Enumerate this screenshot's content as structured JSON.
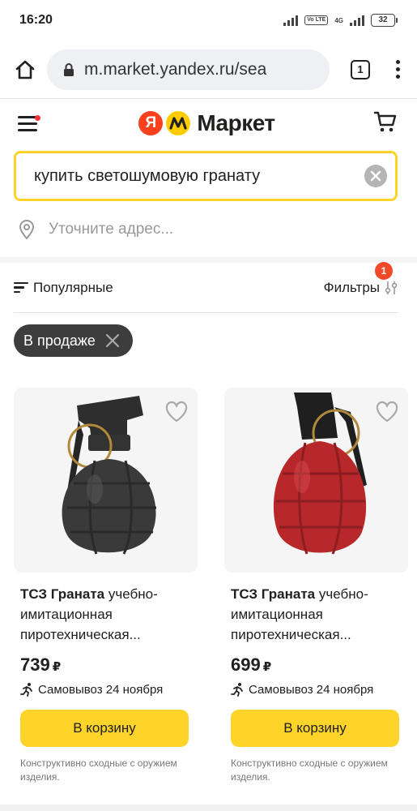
{
  "status_bar": {
    "time": "16:20",
    "network": "4G",
    "volte": "Vo LTE",
    "battery": "32"
  },
  "browser": {
    "url": "m.market.yandex.ru/sea",
    "tab_count": "1"
  },
  "header": {
    "logo_text": "Маркет",
    "logo_ya": "Я"
  },
  "search": {
    "value": "купить светошумовую гранату"
  },
  "address": {
    "placeholder": "Уточните адрес..."
  },
  "controls": {
    "sort_label": "Популярные",
    "filters_label": "Фильтры",
    "filters_badge": "1"
  },
  "chips": [
    {
      "label": "В продаже"
    }
  ],
  "products": [
    {
      "title_bold": "ТСЗ Граната",
      "title_rest": " учебно-имитационная пиротехническая...",
      "price": "739",
      "currency": "₽",
      "delivery": "Самовывоз 24 ноября",
      "cart_label": "В корзину",
      "note": "Конструктивно сходные с оружием изделия.",
      "body_color": "#3a3a3a"
    },
    {
      "title_bold": "ТСЗ Граната",
      "title_rest": " учебно-имитационная пиротехническая...",
      "price": "699",
      "currency": "₽",
      "delivery": "Самовывоз 24 ноября",
      "cart_label": "В корзину",
      "note": "Конструктивно сходные с оружием изделия.",
      "body_color": "#b8272a"
    }
  ],
  "colors": {
    "accent_yellow": "#fed42b",
    "brand_red": "#fc3f1d",
    "badge_red": "#f14a2b",
    "chip_dark": "#3d3d3d"
  }
}
